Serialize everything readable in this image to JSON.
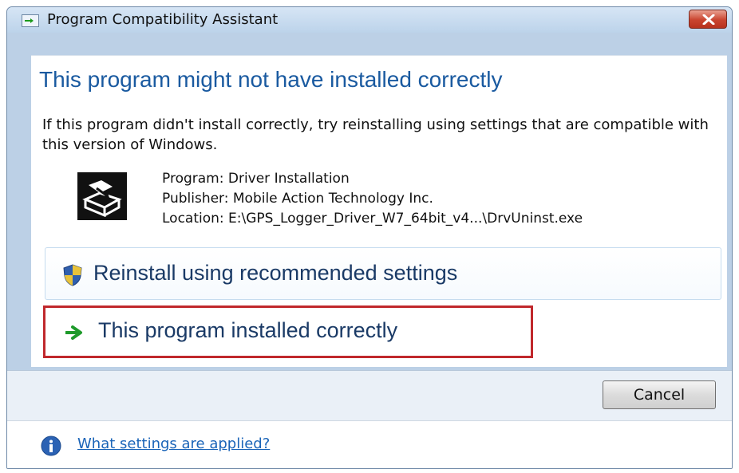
{
  "window": {
    "title": "Program Compatibility Assistant",
    "close_icon": "close-icon"
  },
  "main": {
    "headline": "This program might not have installed correctly",
    "description": "If this program didn't install correctly, try reinstalling using settings that are compatible with this version of Windows.",
    "program_icon": "installer-icon",
    "program": "Program: Driver Installation",
    "publisher": "Publisher: Mobile Action Technology Inc.",
    "location": "Location: E:\\GPS_Logger_Driver_W7_64bit_v4...\\DrvUninst.exe"
  },
  "commands": [
    {
      "label": "Reinstall using recommended settings",
      "icon": "uac-shield-icon"
    },
    {
      "label": "This program installed correctly",
      "icon": "green-arrow-icon",
      "highlight_color": "#c0282c"
    }
  ],
  "buttons": {
    "cancel": "Cancel"
  },
  "footer": {
    "help_link": "What settings are applied?",
    "icon": "info-icon"
  },
  "colors": {
    "headline": "#1a5aa0",
    "link": "#1a64b8",
    "highlight": "#c0282c"
  }
}
